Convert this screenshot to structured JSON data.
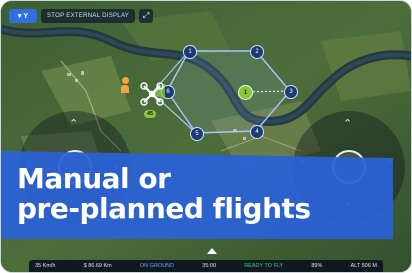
{
  "toolbar": {
    "menu_label": "Y",
    "external_display_label": "STOP EXTERNAL DISPLAY"
  },
  "headline": {
    "line1": "Manual or",
    "line2": "pre-planned flights"
  },
  "waypoints": [
    "1",
    "2",
    "3",
    "4",
    "5",
    "6"
  ],
  "drone_badge": "45",
  "poi_label": "1",
  "status": {
    "speed": "35 Km/h",
    "distance": "$ 86.69 Km",
    "ground": "ON GROUND",
    "time": "35:00",
    "ready": "READY TO FLY",
    "battery": "89%",
    "altitude": "ALT 506 M"
  },
  "colors": {
    "accent": "#2a62d6",
    "ready": "#3fd27b",
    "route": "#a9c8ff"
  }
}
